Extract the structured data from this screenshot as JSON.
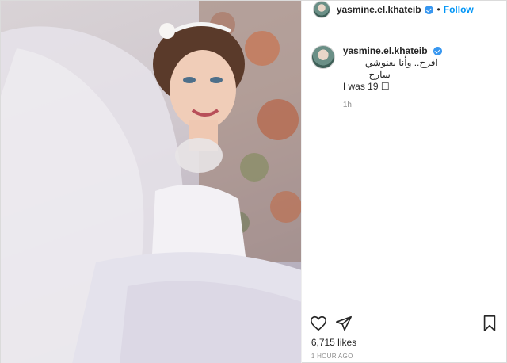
{
  "post": {
    "author": {
      "username": "yasmine.el.khateib",
      "verified": true
    },
    "header": {
      "dot": "•",
      "follow_label": "Follow"
    },
    "caption": {
      "line1_arabic": "افرح.. وأنا بعنوشي",
      "line2_arabic": "سارح",
      "line3": "I was 19 ☐",
      "time": "1h"
    },
    "likes": "6,715 likes",
    "posted_ago": "1 HOUR AGO"
  },
  "icons": {
    "verified": "verified-badge-icon",
    "like": "heart-icon",
    "share": "paper-plane-icon",
    "save": "bookmark-icon"
  },
  "colors": {
    "follow": "#0095f6",
    "verified": "#3897f0",
    "muted": "#8e8e8e"
  }
}
